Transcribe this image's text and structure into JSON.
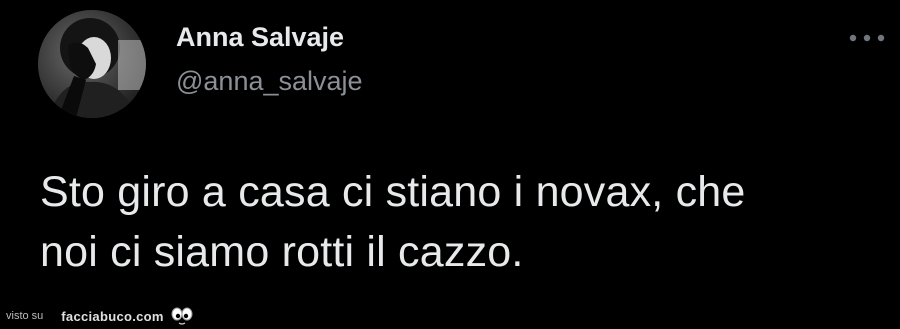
{
  "tweet": {
    "display_name": "Anna Salvaje",
    "handle": "@anna_salvaje",
    "text_lines": [
      "Sto giro a casa ci stiano i novax, che",
      "noi ci siamo rotti il cazzo."
    ],
    "more_icon": "more-horizontal-icon",
    "avatar_icon": "avatar"
  },
  "watermark": {
    "prefix": "visto su",
    "site": "facciabuco.com",
    "logo_icon": "eyes-logo-icon"
  },
  "colors": {
    "background": "#000000",
    "text_primary": "#e7e9ea",
    "text_secondary": "#8b9096"
  }
}
